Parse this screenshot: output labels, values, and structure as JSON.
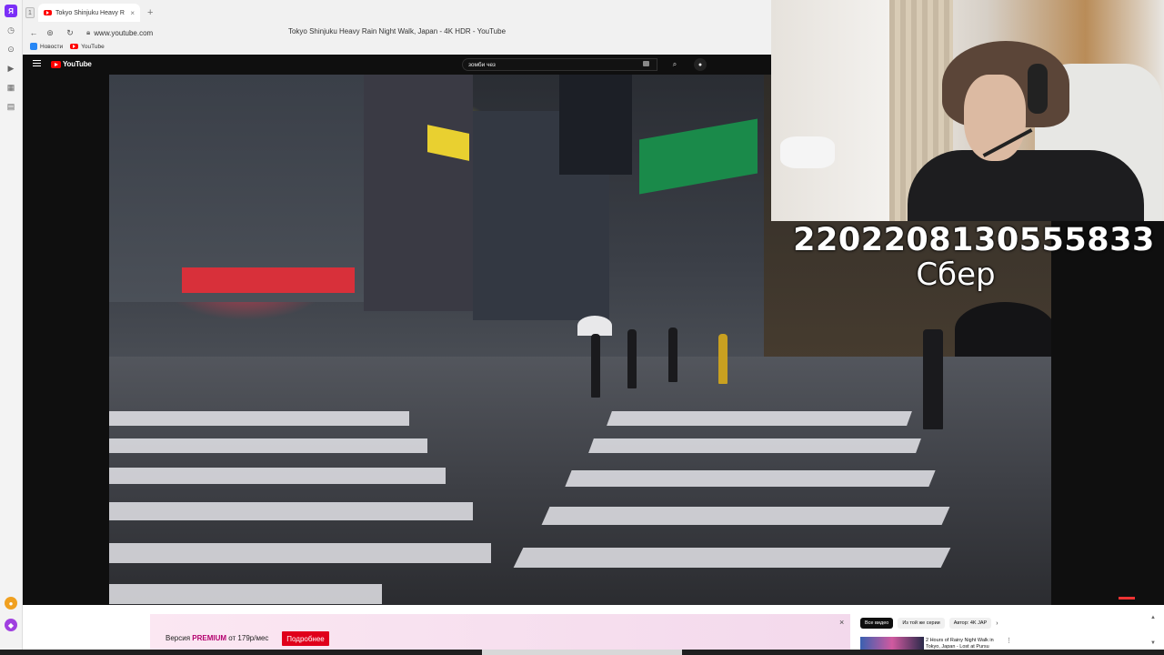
{
  "browser": {
    "tab_counter": "1",
    "tab_title": "Tokyo Shinjuku Heavy R",
    "url": "www.youtube.com",
    "page_title": "Tokyo Shinjuku Heavy Rain Night Walk, Japan - 4K HDR - YouTube",
    "bookmarks": [
      {
        "label": "Новости",
        "icon": "vk-icon"
      },
      {
        "label": "YouTube",
        "icon": "youtube-icon"
      }
    ],
    "sidebar_icons": [
      "browser-logo-icon",
      "history-icon",
      "clock-icon",
      "play-icon",
      "grid-icon",
      "note-icon"
    ]
  },
  "youtube": {
    "logo_text": "YouTube",
    "search_query": "зомби чез"
  },
  "stream_overlay": {
    "donation_number": "2202208130555833",
    "donation_bank": "Сбер"
  },
  "premium_banner": {
    "text_prefix": "Версия ",
    "text_brand": "PREMIUM",
    "text_suffix": " от 179р/мес",
    "button_label": "Подробнее",
    "close_label": "×"
  },
  "recommendations": {
    "chips": [
      {
        "label": "Все видео",
        "active": true
      },
      {
        "label": "Из той же серии",
        "active": false
      },
      {
        "label": "Автор: 4K JAP",
        "active": false
      }
    ],
    "first_title": "2 Hours of Rainy Night Walk in Tokyo, Japan - Lost at Pursu"
  }
}
